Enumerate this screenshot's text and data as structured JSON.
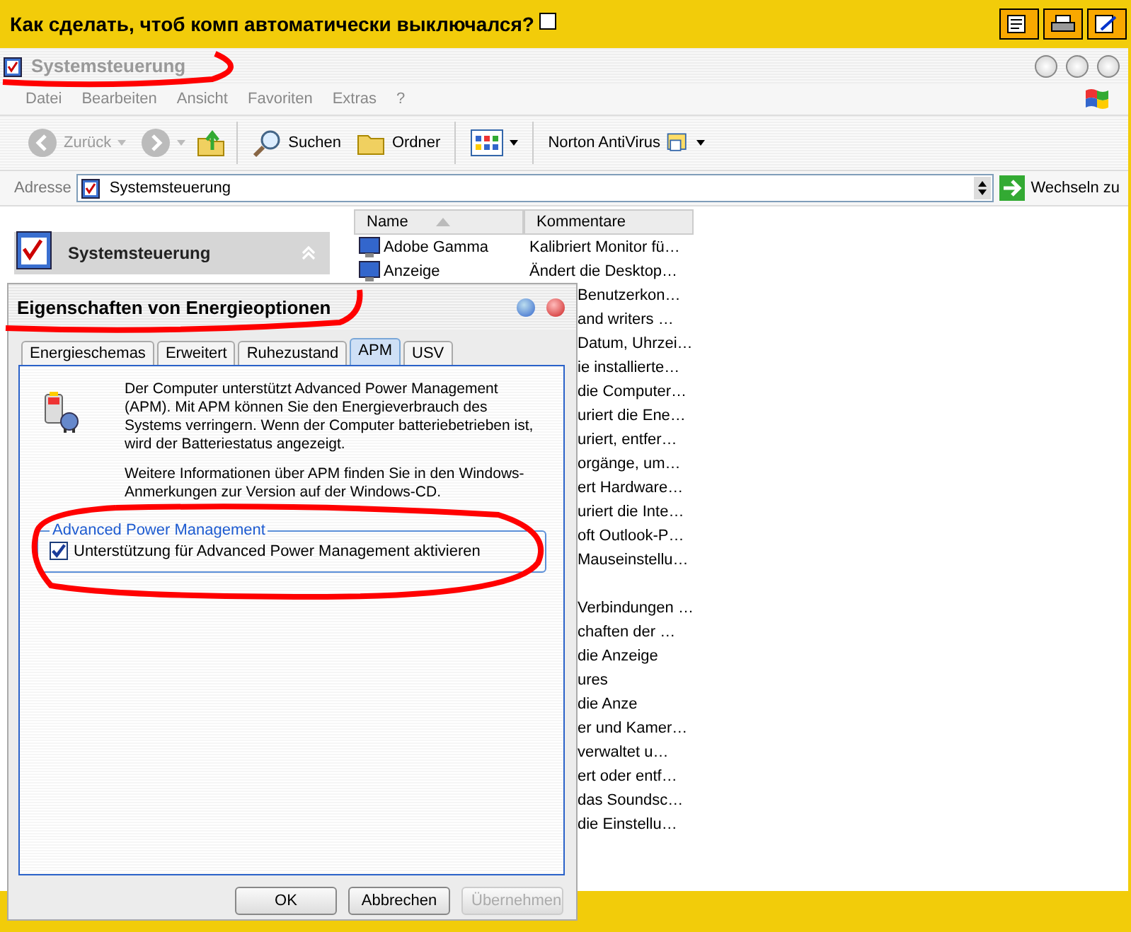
{
  "topic_bar": {
    "title": "Как сделать, чтоб комп автоматически выключался?",
    "checked": false
  },
  "explorer": {
    "title": "Systemsteuerung",
    "menu": [
      "Datei",
      "Bearbeiten",
      "Ansicht",
      "Favoriten",
      "Extras",
      "?"
    ],
    "toolbar": {
      "back": "Zurück",
      "search": "Suchen",
      "folders": "Ordner",
      "norton": "Norton AntiVirus"
    },
    "address": {
      "label": "Adresse",
      "value": "Systemsteuerung",
      "go": "Wechseln zu"
    },
    "task_pane": {
      "title": "Systemsteuerung"
    },
    "list": {
      "columns": [
        "Name",
        "Kommentare"
      ],
      "rows": [
        {
          "name": "Adobe Gamma",
          "comment": "Kalibriert Monitor fü…"
        },
        {
          "name": "Anzeige",
          "comment": "Ändert die Desktop…"
        },
        {
          "comment": "Benutzerkon…"
        },
        {
          "comment": "and writers …"
        },
        {
          "comment": "Datum, Uhrzei…"
        },
        {
          "comment": "ie installierte…"
        },
        {
          "comment": "die Computer…"
        },
        {
          "comment": "uriert die Ene…"
        },
        {
          "comment": "uriert, entfer…"
        },
        {
          "comment": "orgänge, um…"
        },
        {
          "comment": "ert Hardware…"
        },
        {
          "comment": "uriert die Inte…"
        },
        {
          "comment": "oft Outlook-P…"
        },
        {
          "comment": "Mauseinstellu…"
        },
        {
          "comment": "Verbindungen …",
          "gap_before": true
        },
        {
          "comment": "chaften der …"
        },
        {
          "comment": "die Anzeige"
        },
        {
          "comment": "ures"
        },
        {
          "comment": "die Anze"
        },
        {
          "comment": "er und Kamer…"
        },
        {
          "comment": "verwaltet u…"
        },
        {
          "comment": "ert oder entf…"
        },
        {
          "comment": "das Soundsc…"
        },
        {
          "comment": "die Einstellu…"
        }
      ]
    }
  },
  "dialog": {
    "title": "Eigenschaften von Energieoptionen",
    "tabs": [
      {
        "label": "Energieschemas",
        "selected": false
      },
      {
        "label": "Erweitert",
        "selected": false
      },
      {
        "label": "Ruhezustand",
        "selected": false
      },
      {
        "label": "APM",
        "selected": true
      },
      {
        "label": "USV",
        "selected": false
      }
    ],
    "paragraphs": [
      "Der Computer unterstützt Advanced Power Management (APM). Mit APM können Sie den Energieverbrauch des Systems verringern. Wenn der Computer batteriebetrieben ist, wird der Batteriestatus angezeigt.",
      "Weitere Informationen über APM finden Sie in den Windows-Anmerkungen zur Version auf der Windows-CD."
    ],
    "group": {
      "title": "Advanced Power Management",
      "checkbox": {
        "label": "Unterstützung für Advanced Power Management aktivieren",
        "checked": true
      }
    },
    "buttons": [
      {
        "label": "OK",
        "disabled": false
      },
      {
        "label": "Abbrechen",
        "disabled": false
      },
      {
        "label": "Übernehmen",
        "disabled": true
      }
    ]
  }
}
